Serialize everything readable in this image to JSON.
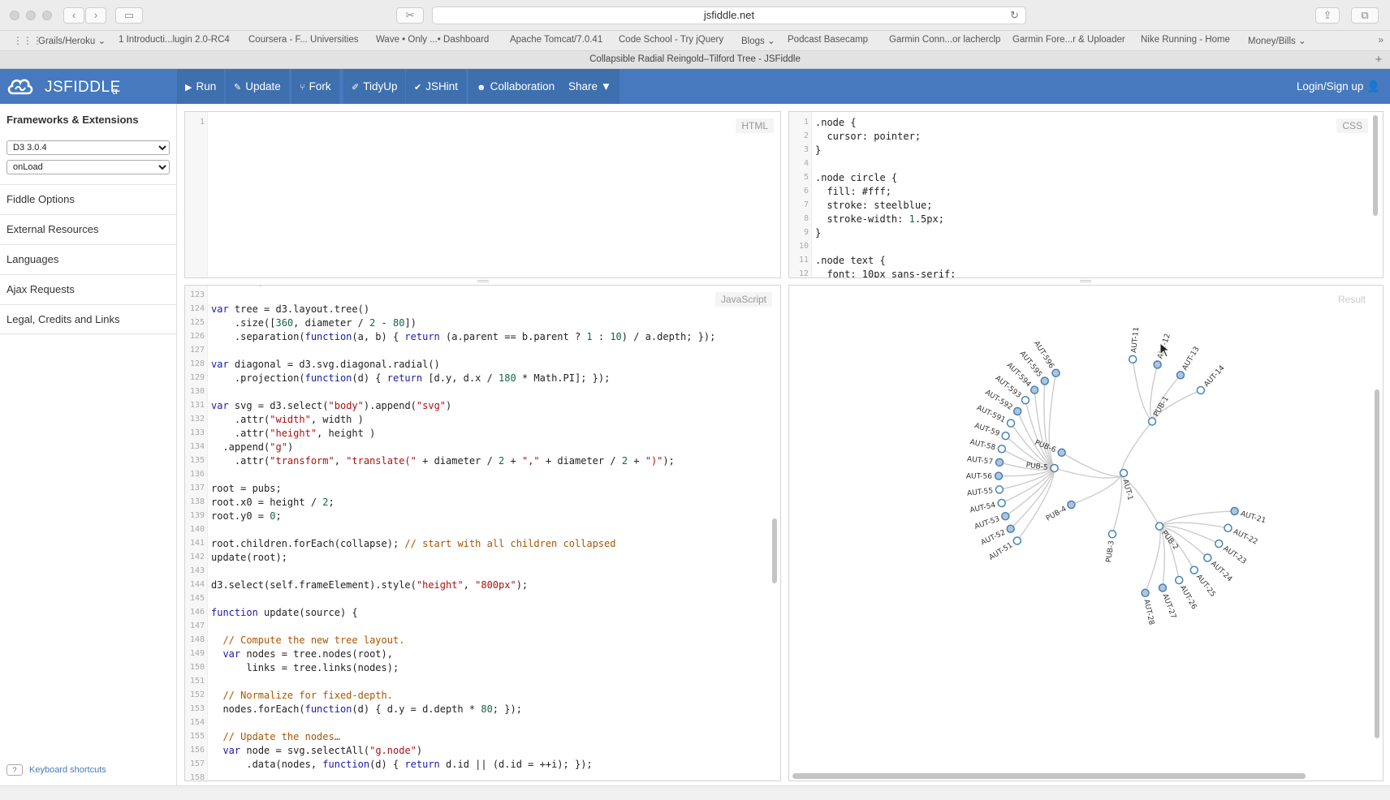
{
  "browser": {
    "url": "jsfiddle.net",
    "tab_title": "Collapsible Radial Reingold–Tilford Tree - JSFiddle",
    "bookmarks": [
      "Grails/Heroku ⌄",
      "1 Introducti...lugin 2.0-RC4",
      "Coursera - F... Universities",
      "Wave • Only ...• Dashboard",
      "Apache Tomcat/7.0.41",
      "Code School - Try jQuery",
      "Blogs ⌄",
      "Podcast Basecamp",
      "Garmin Conn...or lacherclp",
      "Garmin Fore...r & Uploader",
      "Nike Running - Home",
      "Money/Bills ⌄"
    ]
  },
  "header": {
    "brand": "JSFIDDLE",
    "alpha": "α",
    "buttons": {
      "run": "Run",
      "update": "Update",
      "fork": "Fork",
      "tidyup": "TidyUp",
      "jshint": "JSHint",
      "collaboration": "Collaboration",
      "share": "Share ▼"
    },
    "login": "Login/Sign up"
  },
  "sidebar": {
    "title": "Frameworks & Extensions",
    "framework": "D3 3.0.4",
    "load": "onLoad",
    "items": [
      "Fiddle Options",
      "External Resources",
      "Languages",
      "Ajax Requests",
      "Legal, Credits and Links"
    ],
    "keyboard": "Keyboard shortcuts",
    "keyboard_key": "?"
  },
  "panels": {
    "html_label": "HTML",
    "css_label": "CSS",
    "js_label": "JavaScript",
    "result_label": "Result"
  },
  "html_code": {
    "lines": [
      {
        "n": "1",
        "t": ""
      }
    ]
  },
  "css_code": {
    "lines": [
      {
        "n": "1",
        "t": ".node {"
      },
      {
        "n": "2",
        "t": "  cursor: pointer;"
      },
      {
        "n": "3",
        "t": "}"
      },
      {
        "n": "4",
        "t": ""
      },
      {
        "n": "5",
        "t": ".node circle {"
      },
      {
        "n": "6",
        "t": "  fill: #fff;"
      },
      {
        "n": "7",
        "t": "  stroke: steelblue;"
      },
      {
        "n": "8",
        "t": "  stroke-width: 1.5px;"
      },
      {
        "n": "9",
        "t": "}"
      },
      {
        "n": "10",
        "t": ""
      },
      {
        "n": "11",
        "t": ".node text {"
      },
      {
        "n": "12",
        "t": "  font: 10px sans-serif;"
      }
    ]
  },
  "js_code": {
    "first_partial": "    root;",
    "lines": [
      {
        "n": "123",
        "t": ""
      },
      {
        "n": "124",
        "t": "var tree = d3.layout.tree()"
      },
      {
        "n": "125",
        "t": "    .size([360, diameter / 2 - 80])"
      },
      {
        "n": "126",
        "t": "    .separation(function(a, b) { return (a.parent == b.parent ? 1 : 10) / a.depth; });"
      },
      {
        "n": "127",
        "t": ""
      },
      {
        "n": "128",
        "t": "var diagonal = d3.svg.diagonal.radial()"
      },
      {
        "n": "129",
        "t": "    .projection(function(d) { return [d.y, d.x / 180 * Math.PI]; });"
      },
      {
        "n": "130",
        "t": ""
      },
      {
        "n": "131",
        "t": "var svg = d3.select(\"body\").append(\"svg\")"
      },
      {
        "n": "132",
        "t": "    .attr(\"width\", width )"
      },
      {
        "n": "133",
        "t": "    .attr(\"height\", height )"
      },
      {
        "n": "134",
        "t": "  .append(\"g\")"
      },
      {
        "n": "135",
        "t": "    .attr(\"transform\", \"translate(\" + diameter / 2 + \",\" + diameter / 2 + \")\");"
      },
      {
        "n": "136",
        "t": ""
      },
      {
        "n": "137",
        "t": "root = pubs;"
      },
      {
        "n": "138",
        "t": "root.x0 = height / 2;"
      },
      {
        "n": "139",
        "t": "root.y0 = 0;"
      },
      {
        "n": "140",
        "t": ""
      },
      {
        "n": "141",
        "t": "root.children.forEach(collapse); // start with all children collapsed"
      },
      {
        "n": "142",
        "t": "update(root);"
      },
      {
        "n": "143",
        "t": ""
      },
      {
        "n": "144",
        "t": "d3.select(self.frameElement).style(\"height\", \"800px\");"
      },
      {
        "n": "145",
        "t": ""
      },
      {
        "n": "146",
        "t": "function update(source) {"
      },
      {
        "n": "147",
        "t": ""
      },
      {
        "n": "148",
        "t": "  // Compute the new tree layout."
      },
      {
        "n": "149",
        "t": "  var nodes = tree.nodes(root),"
      },
      {
        "n": "150",
        "t": "      links = tree.links(nodes);"
      },
      {
        "n": "151",
        "t": ""
      },
      {
        "n": "152",
        "t": "  // Normalize for fixed-depth."
      },
      {
        "n": "153",
        "t": "  nodes.forEach(function(d) { d.y = d.depth * 80; });"
      },
      {
        "n": "154",
        "t": ""
      },
      {
        "n": "155",
        "t": "  // Update the nodes…"
      },
      {
        "n": "156",
        "t": "  var node = svg.selectAll(\"g.node\")"
      },
      {
        "n": "157",
        "t": "      .data(nodes, function(d) { return d.id || (d.id = ++i); });"
      },
      {
        "n": "158",
        "t": ""
      }
    ]
  },
  "result_tree": {
    "root": "AUT-1",
    "pubs": [
      "PUB-1",
      "PUB-2",
      "PUB-3",
      "PUB-4",
      "PUB-5",
      "PUB-6"
    ],
    "pub1_children": [
      "AUT-11",
      "AUT-12",
      "AUT-13",
      "AUT-14"
    ],
    "pub2_children": [
      "AUT-21",
      "AUT-22",
      "AUT-23",
      "AUT-24",
      "AUT-25",
      "AUT-26",
      "AUT-27",
      "AUT-28"
    ],
    "pub5_children": [
      "AUT-596",
      "AUT-595",
      "AUT-594",
      "AUT-593",
      "AUT-592",
      "AUT-591",
      "AUT-59",
      "AUT-58",
      "AUT-57",
      "AUT-56",
      "AUT-55",
      "AUT-54",
      "AUT-53",
      "AUT-52",
      "AUT-51"
    ],
    "colors": {
      "link": "#cccccc",
      "stroke": "#4682b4",
      "collapsed_fill": "#b0c4de",
      "fill": "#ffffff"
    }
  }
}
